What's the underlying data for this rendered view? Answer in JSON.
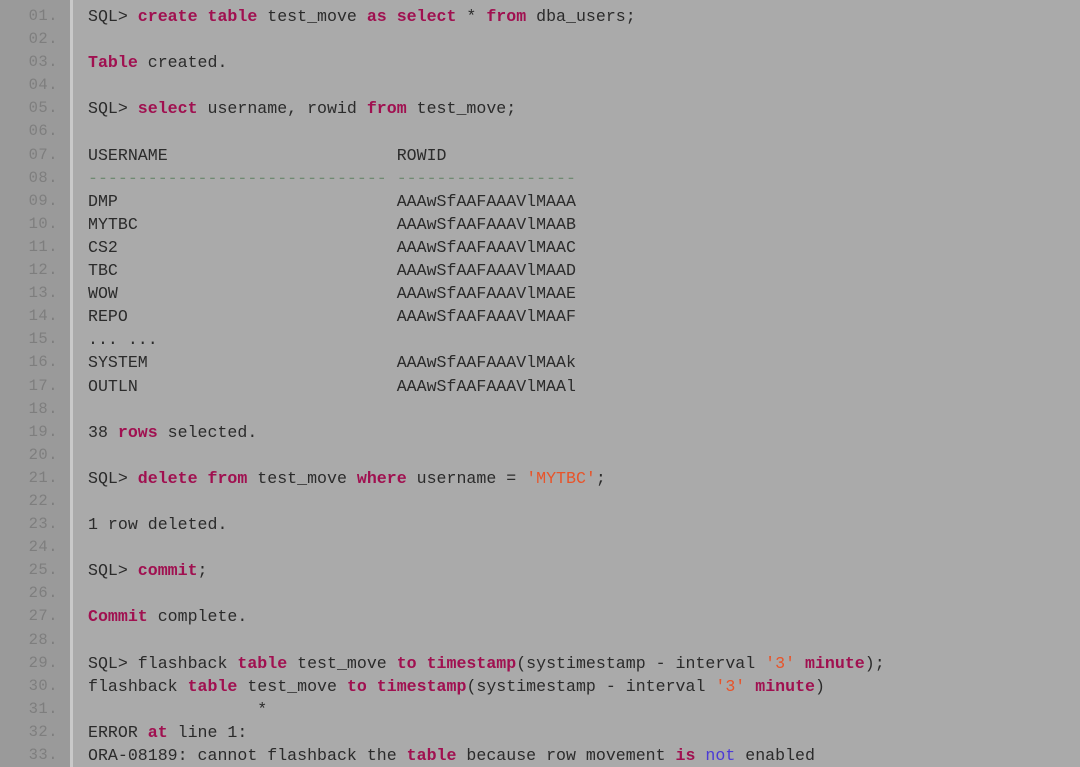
{
  "terminal": {
    "kind": "sqlplus-transcript",
    "background_color": "#aaaaaa",
    "gutter_color": "#9a9a9a",
    "text_color": "#2b2b2b",
    "keyword_color": "#a01050",
    "string_color": "#e8542a",
    "operator_color": "#4b3ad6",
    "separator_color": "#6f8a72",
    "line_numbers": [
      "01.",
      "02.",
      "03.",
      "04.",
      "05.",
      "06.",
      "07.",
      "08.",
      "09.",
      "10.",
      "11.",
      "12.",
      "13.",
      "14.",
      "15.",
      "16.",
      "17.",
      "18.",
      "19.",
      "20.",
      "21.",
      "22.",
      "23.",
      "24.",
      "25.",
      "26.",
      "27.",
      "28.",
      "29.",
      "30.",
      "31.",
      "32.",
      "33."
    ],
    "lines": [
      {
        "n": "01.",
        "tokens": [
          {
            "t": "SQL> ",
            "c": "plain"
          },
          {
            "t": "create table",
            "c": "kw"
          },
          {
            "t": " test_move ",
            "c": "plain"
          },
          {
            "t": "as select",
            "c": "kw"
          },
          {
            "t": " * ",
            "c": "plain"
          },
          {
            "t": "from",
            "c": "kw"
          },
          {
            "t": " dba_users;",
            "c": "plain"
          }
        ]
      },
      {
        "n": "02.",
        "tokens": []
      },
      {
        "n": "03.",
        "tokens": [
          {
            "t": "Table",
            "c": "kw"
          },
          {
            "t": " created.",
            "c": "plain"
          }
        ]
      },
      {
        "n": "04.",
        "tokens": []
      },
      {
        "n": "05.",
        "tokens": [
          {
            "t": "SQL> ",
            "c": "plain"
          },
          {
            "t": "select",
            "c": "kw"
          },
          {
            "t": " username, rowid ",
            "c": "plain"
          },
          {
            "t": "from",
            "c": "kw"
          },
          {
            "t": " test_move;",
            "c": "plain"
          }
        ]
      },
      {
        "n": "06.",
        "tokens": []
      },
      {
        "n": "07.",
        "tokens": [
          {
            "t": "USERNAME                       ROWID",
            "c": "plain"
          }
        ]
      },
      {
        "n": "08.",
        "tokens": [
          {
            "t": "------------------------------ ------------------",
            "c": "dash"
          }
        ]
      },
      {
        "n": "09.",
        "tokens": [
          {
            "t": "DMP                            AAAwSfAAFAAAVlMAAA",
            "c": "plain"
          }
        ]
      },
      {
        "n": "10.",
        "tokens": [
          {
            "t": "MYTBC                          AAAwSfAAFAAAVlMAAB",
            "c": "plain"
          }
        ]
      },
      {
        "n": "11.",
        "tokens": [
          {
            "t": "CS2                            AAAwSfAAFAAAVlMAAC",
            "c": "plain"
          }
        ]
      },
      {
        "n": "12.",
        "tokens": [
          {
            "t": "TBC                            AAAwSfAAFAAAVlMAAD",
            "c": "plain"
          }
        ]
      },
      {
        "n": "13.",
        "tokens": [
          {
            "t": "WOW                            AAAwSfAAFAAAVlMAAE",
            "c": "plain"
          }
        ]
      },
      {
        "n": "14.",
        "tokens": [
          {
            "t": "REPO                           AAAwSfAAFAAAVlMAAF",
            "c": "plain"
          }
        ]
      },
      {
        "n": "15.",
        "tokens": [
          {
            "t": "... ...",
            "c": "plain"
          }
        ]
      },
      {
        "n": "16.",
        "tokens": [
          {
            "t": "SYSTEM                         AAAwSfAAFAAAVlMAAk",
            "c": "plain"
          }
        ]
      },
      {
        "n": "17.",
        "tokens": [
          {
            "t": "OUTLN                          AAAwSfAAFAAAVlMAAl",
            "c": "plain"
          }
        ]
      },
      {
        "n": "18.",
        "tokens": []
      },
      {
        "n": "19.",
        "tokens": [
          {
            "t": "38 ",
            "c": "plain"
          },
          {
            "t": "rows",
            "c": "kw"
          },
          {
            "t": " selected.",
            "c": "plain"
          }
        ]
      },
      {
        "n": "20.",
        "tokens": []
      },
      {
        "n": "21.",
        "tokens": [
          {
            "t": "SQL> ",
            "c": "plain"
          },
          {
            "t": "delete from",
            "c": "kw"
          },
          {
            "t": " test_move ",
            "c": "plain"
          },
          {
            "t": "where",
            "c": "kw"
          },
          {
            "t": " username = ",
            "c": "plain"
          },
          {
            "t": "'MYTBC'",
            "c": "str"
          },
          {
            "t": ";",
            "c": "plain"
          }
        ]
      },
      {
        "n": "22.",
        "tokens": []
      },
      {
        "n": "23.",
        "tokens": [
          {
            "t": "1 row deleted.",
            "c": "plain"
          }
        ]
      },
      {
        "n": "24.",
        "tokens": []
      },
      {
        "n": "25.",
        "tokens": [
          {
            "t": "SQL> ",
            "c": "plain"
          },
          {
            "t": "commit",
            "c": "kw"
          },
          {
            "t": ";",
            "c": "plain"
          }
        ]
      },
      {
        "n": "26.",
        "tokens": []
      },
      {
        "n": "27.",
        "tokens": [
          {
            "t": "Commit",
            "c": "kw"
          },
          {
            "t": " complete.",
            "c": "plain"
          }
        ]
      },
      {
        "n": "28.",
        "tokens": []
      },
      {
        "n": "29.",
        "tokens": [
          {
            "t": "SQL> flashback ",
            "c": "plain"
          },
          {
            "t": "table",
            "c": "kw"
          },
          {
            "t": " test_move ",
            "c": "plain"
          },
          {
            "t": "to timestamp",
            "c": "kw"
          },
          {
            "t": "(systimestamp - interval ",
            "c": "plain"
          },
          {
            "t": "'3'",
            "c": "str"
          },
          {
            "t": " ",
            "c": "plain"
          },
          {
            "t": "minute",
            "c": "kw"
          },
          {
            "t": ");",
            "c": "plain"
          }
        ]
      },
      {
        "n": "30.",
        "tokens": [
          {
            "t": "flashback ",
            "c": "plain"
          },
          {
            "t": "table",
            "c": "kw"
          },
          {
            "t": " test_move ",
            "c": "plain"
          },
          {
            "t": "to timestamp",
            "c": "kw"
          },
          {
            "t": "(systimestamp - interval ",
            "c": "plain"
          },
          {
            "t": "'3'",
            "c": "str"
          },
          {
            "t": " ",
            "c": "plain"
          },
          {
            "t": "minute",
            "c": "kw"
          },
          {
            "t": ")",
            "c": "plain"
          }
        ]
      },
      {
        "n": "31.",
        "tokens": [
          {
            "t": "                 *",
            "c": "plain"
          }
        ]
      },
      {
        "n": "32.",
        "tokens": [
          {
            "t": "ERROR ",
            "c": "plain"
          },
          {
            "t": "at",
            "c": "kw"
          },
          {
            "t": " line 1:",
            "c": "plain"
          }
        ]
      },
      {
        "n": "33.",
        "tokens": [
          {
            "t": "ORA-08189: cannot flashback the ",
            "c": "plain"
          },
          {
            "t": "table",
            "c": "kw"
          },
          {
            "t": " because row movement ",
            "c": "plain"
          },
          {
            "t": "is",
            "c": "kw"
          },
          {
            "t": " ",
            "c": "plain"
          },
          {
            "t": "not",
            "c": "not"
          },
          {
            "t": " enabled",
            "c": "plain"
          }
        ]
      }
    ]
  }
}
